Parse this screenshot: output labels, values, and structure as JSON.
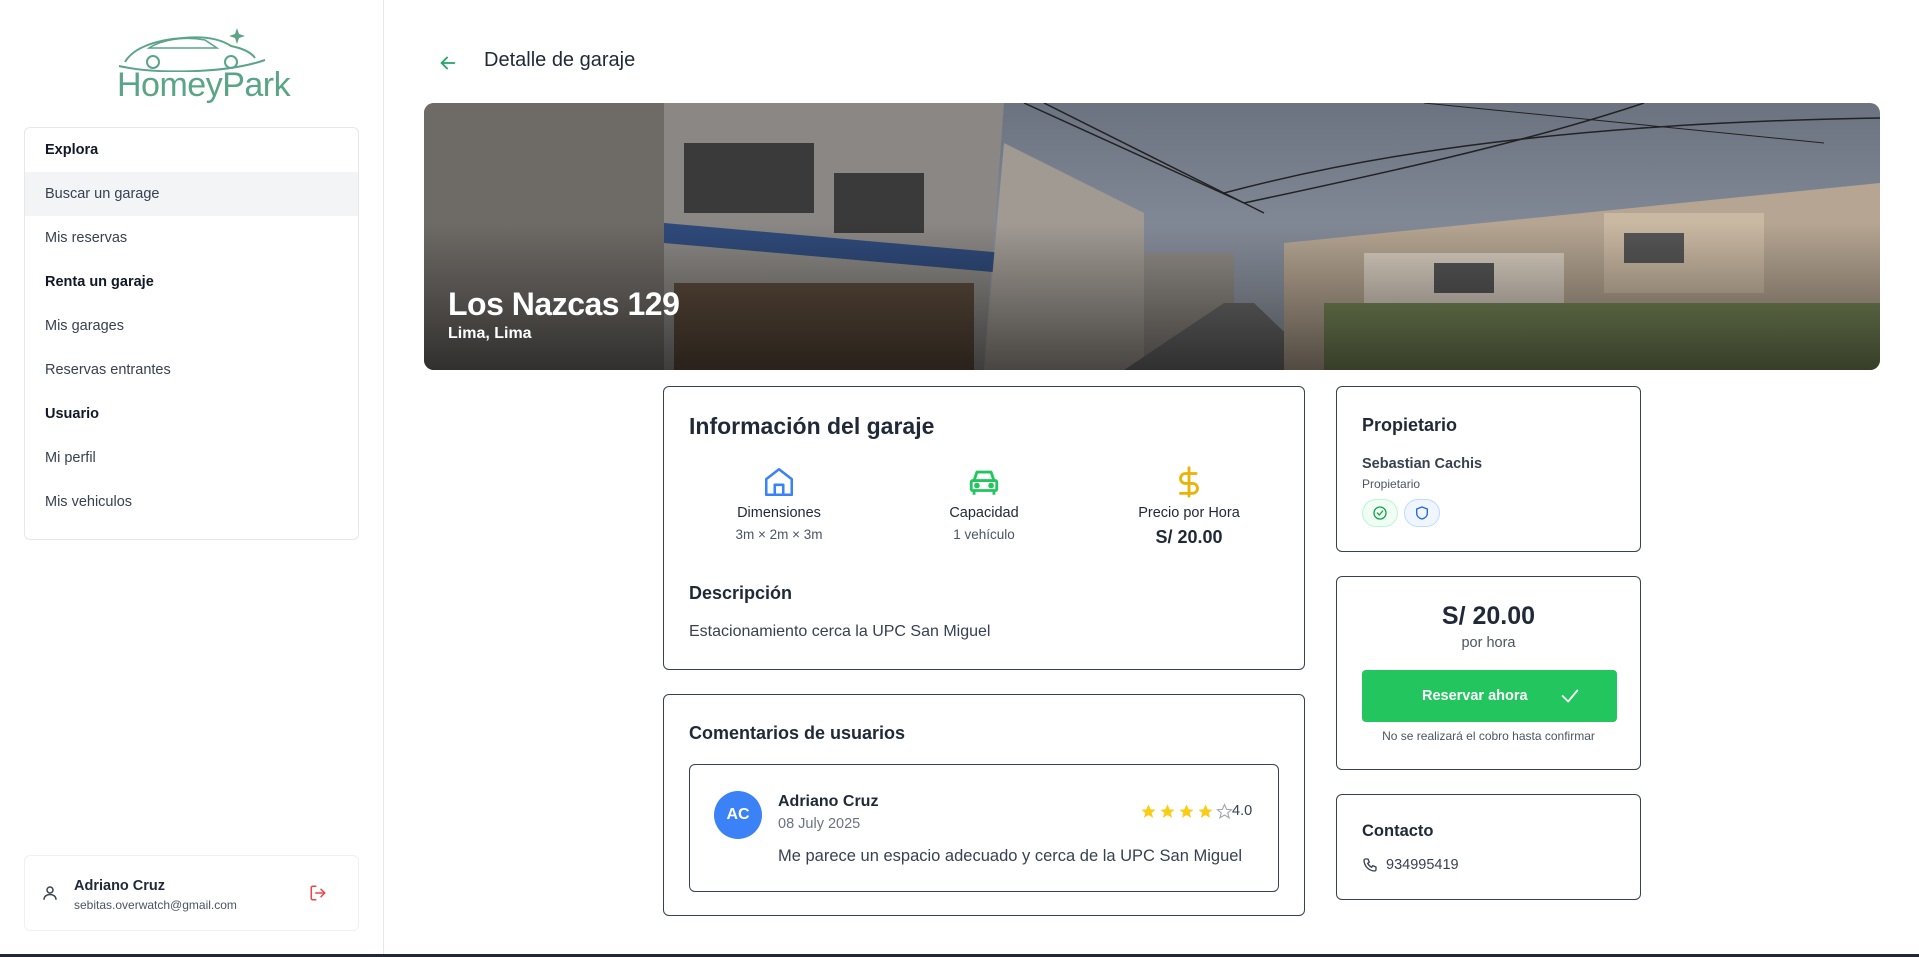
{
  "app": {
    "logo_text": "HomeyPark"
  },
  "sidebar": {
    "sections": [
      {
        "label": "Explora"
      },
      {
        "label": "Renta un garaje"
      },
      {
        "label": "Usuario"
      }
    ],
    "items": [
      {
        "label": "Buscar un garage",
        "active": true
      },
      {
        "label": "Mis reservas"
      },
      {
        "label": "Mis garages"
      },
      {
        "label": "Reservas entrantes"
      },
      {
        "label": "Mi perfil"
      },
      {
        "label": "Mis vehiculos"
      }
    ],
    "user": {
      "name": "Adriano Cruz",
      "email": "sebitas.overwatch@gmail.com"
    }
  },
  "header": {
    "title": "Detalle de garaje"
  },
  "hero": {
    "title": "Los Nazcas 129",
    "subtitle": "Lima, Lima"
  },
  "info": {
    "title": "Información del garaje",
    "features": [
      {
        "icon": "house-icon",
        "label": "Dimensiones",
        "value": "3m × 2m × 3m"
      },
      {
        "icon": "car-icon",
        "label": "Capacidad",
        "value": "1 vehículo"
      },
      {
        "icon": "dollar-icon",
        "label": "Precio por Hora",
        "value": "S/ 20.00"
      }
    ],
    "description_title": "Descripción",
    "description": "Estacionamiento cerca la UPC San Miguel"
  },
  "comments": {
    "title": "Comentarios de usuarios",
    "items": [
      {
        "initials": "AC",
        "name": "Adriano Cruz",
        "date": "08 July 2025",
        "rating": 4,
        "rating_text": "4.0",
        "text": "Me parece un espacio adecuado y cerca de la UPC San Miguel"
      }
    ]
  },
  "owner": {
    "title": "Propietario",
    "name": "Sebastian Cachis",
    "role": "Propietario"
  },
  "pricing": {
    "price": "S/ 20.00",
    "unit": "por hora",
    "button_label": "Reservar ahora",
    "note": "No se realizará el cobro hasta confirmar"
  },
  "contact": {
    "title": "Contacto",
    "phone": "934995419"
  },
  "colors": {
    "brand": "#5aa487",
    "primary_button": "#22c55e",
    "avatar": "#3b82f6",
    "star": "#facc15",
    "logout": "#ef4444"
  }
}
